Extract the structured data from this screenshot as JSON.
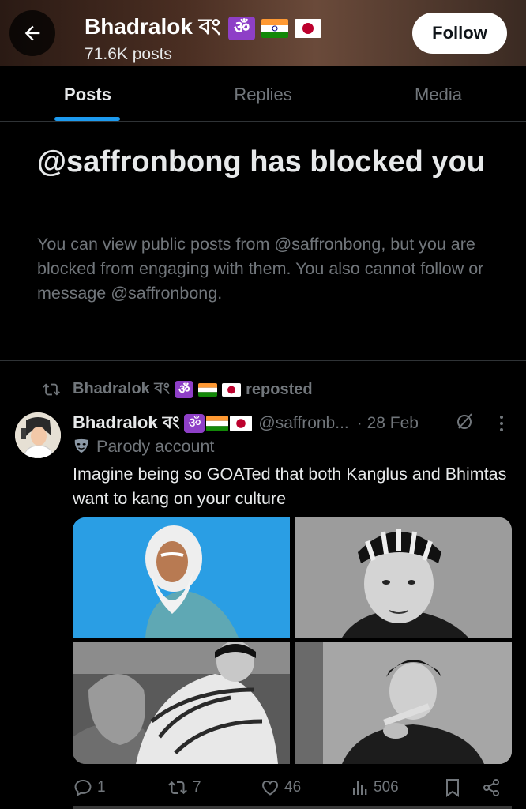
{
  "header": {
    "back_icon": "arrow-left-icon",
    "display_name": "Bhadralok বং",
    "post_count": "71.6K posts",
    "follow_label": "Follow",
    "badges": [
      "om-icon",
      "india-flag",
      "japan-flag"
    ]
  },
  "tabs": [
    {
      "label": "Posts",
      "active": true
    },
    {
      "label": "Replies",
      "active": false
    },
    {
      "label": "Media",
      "active": false
    }
  ],
  "blocked": {
    "title": "@saffronbong has blocked you",
    "description": "You can view public posts from @saffronbong, but you are blocked from engaging with them. You also cannot follow or message @saffronbong."
  },
  "repost": {
    "icon": "repost-icon",
    "name": "Bhadralok বং",
    "suffix": "reposted"
  },
  "post": {
    "display_name": "Bhadralok বং",
    "handle": "@saffronb...",
    "date": "· 28 Feb",
    "label_icon": "parody-mask-icon",
    "label": "Parody account",
    "text": "Imagine being so GOATed that both Kanglus and Bhimtas want to kang on your culture",
    "media_count": 4,
    "actions": {
      "replies": "1",
      "reposts": "7",
      "likes": "46",
      "views": "506"
    }
  },
  "colors": {
    "background": "#000000",
    "text_primary": "#e7e9ea",
    "text_secondary": "#71767b",
    "accent": "#1d9bf0",
    "divider": "#2f3336"
  }
}
